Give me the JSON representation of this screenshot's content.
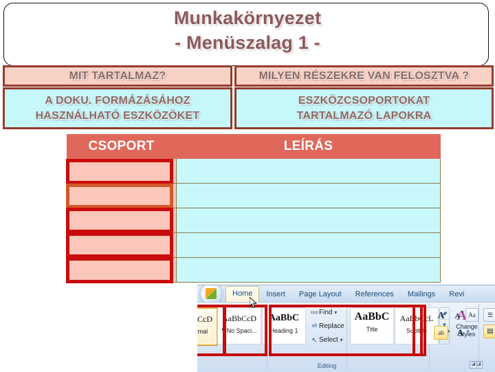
{
  "slide": {
    "title_line1": "Munkakörnyezet",
    "title_line2": "- Menüszalag 1 -",
    "title_color": "#8a5a5a"
  },
  "qa": {
    "question_left": "MIT TARTALMAZ?",
    "question_right": "MILYEN RÉSZEKRE VAN FELOSZTVA ?",
    "answer_left_line1": "A DOKU. FORMÁZÁSÁHOZ",
    "answer_left_line2": "HASZNÁLHATÓ ESZKÖZÖKET",
    "answer_right_line1": "ESZKÖZCSOPORTOKAT",
    "answer_right_line2": "TARTALMAZÓ LAPOKRA",
    "question_fill": "#f9d2c6",
    "answer_fill": "#c6f7f9",
    "box_border": "#943d2d"
  },
  "table": {
    "headers": [
      "CSOPORT",
      "LEÍRÁS"
    ],
    "header_fill": "#e0685a",
    "group_fill": "#fbc7ba",
    "desc_fill": "#c8f8fb",
    "rows": [
      {
        "group": "",
        "desc": ""
      },
      {
        "group": "",
        "desc": ""
      },
      {
        "group": "",
        "desc": ""
      },
      {
        "group": "",
        "desc": ""
      },
      {
        "group": "",
        "desc": ""
      }
    ],
    "highlight_color": "#c90b0b",
    "highlight_color_alt": "#d2592a"
  },
  "ribbon": {
    "office_button": "office-orb",
    "tabs": [
      {
        "label": "Home",
        "active": true
      },
      {
        "label": "Insert",
        "active": false
      },
      {
        "label": "Page Layout",
        "active": false
      },
      {
        "label": "References",
        "active": false
      },
      {
        "label": "Mailings",
        "active": false
      },
      {
        "label": "Revi",
        "active": false
      }
    ],
    "styles_gallery": [
      {
        "sample": "AaBbCcD",
        "name": "¶ Normal",
        "selected": true
      },
      {
        "sample": "AaBbCcD",
        "name": "¶ No Spaci...",
        "selected": false
      },
      {
        "sample": "AaBbC",
        "name": "Heading 1",
        "selected": false
      },
      {
        "sample": "AaBbC",
        "name": "Title",
        "selected": false
      },
      {
        "sample": "AaBbCcL",
        "name": "Subtitle",
        "selected": false
      }
    ],
    "editing": {
      "group_label": "Editing",
      "items": [
        {
          "label": "Find",
          "icon": "binoculars-icon",
          "caret": "▾"
        },
        {
          "label": "Replace",
          "icon": "replace-icon",
          "caret": ""
        },
        {
          "label": "Select",
          "icon": "pointer-icon",
          "caret": "▾"
        }
      ]
    },
    "change_styles": {
      "glyph": "AA",
      "line1": "Change",
      "line2": "Styles",
      "caret": "▾"
    },
    "scroll_buttons": [
      "▲",
      "▼",
      "▤"
    ],
    "font_group": {
      "grow_font": "A",
      "shrink_font": "A",
      "clear_formatting": "Aa",
      "highlight": "ab",
      "font_color": "A"
    },
    "paragraph_group": {
      "bullets": "☰",
      "align": "▤"
    },
    "dialog_launcher": "◪"
  }
}
